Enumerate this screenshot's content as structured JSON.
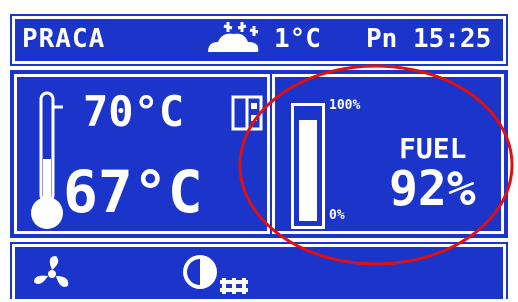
{
  "status": {
    "mode": "PRACA",
    "weather_icon": "snow-cloud-icon",
    "temperature": "1°C",
    "day_time": "Pn 15:25"
  },
  "boiler": {
    "setpoint": "70°C",
    "current": "67°C",
    "thermometer_icon": "thermometer-icon",
    "mode_icon": "heating-mode-icon"
  },
  "fuel": {
    "title": "FUEL",
    "percent": "92%",
    "level": 0.92,
    "max_label": "100%",
    "min_label": "0%"
  },
  "bottom": {
    "fan_icon": "fan-icon",
    "pump_icon": "pump-icon"
  },
  "colors": {
    "screen": "#1b34c9",
    "text": "#ffffff",
    "highlight": "#e01010"
  }
}
